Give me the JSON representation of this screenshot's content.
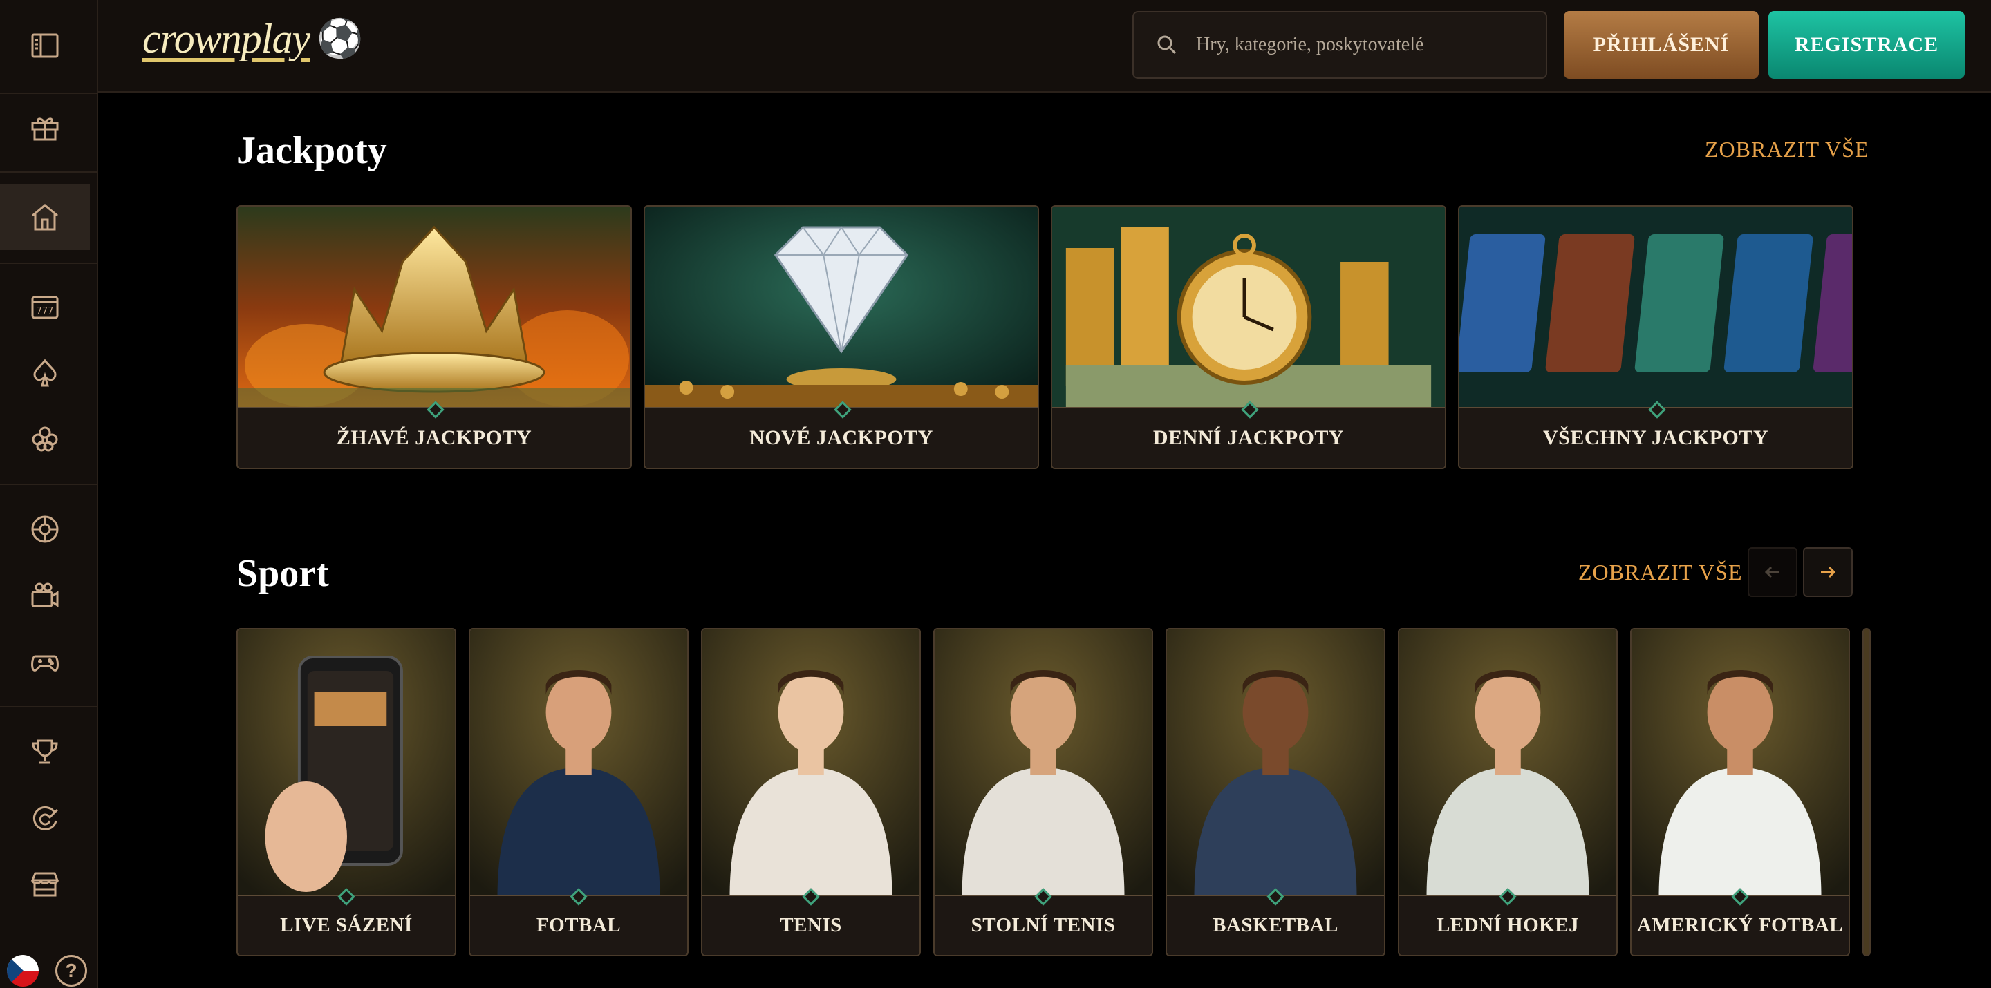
{
  "brand": {
    "logo_text": "crownplay",
    "logo_ball": "⚽"
  },
  "header": {
    "search_placeholder": "Hry, kategorie, poskytovatelé",
    "login_label": "PŘIHLÁŠENÍ",
    "register_label": "REGISTRACE"
  },
  "sidebar": {
    "icons": [
      "sidebar-toggle-icon",
      "gift-icon",
      "home-icon",
      "slot-machine-icon",
      "spade-icon",
      "clover-icon",
      "sports-ball-icon",
      "live-camera-icon",
      "gamepad-icon",
      "trophy-icon",
      "promotions-icon",
      "shop-icon"
    ],
    "help_label": "?",
    "language": "cs"
  },
  "jackpots": {
    "title": "Jackpoty",
    "show_all": "ZOBRAZIT VŠE",
    "cards": [
      {
        "label": "ŽHAVÉ JACKPOTY"
      },
      {
        "label": "NOVÉ JACKPOTY"
      },
      {
        "label": "DENNÍ JACKPOTY"
      },
      {
        "label": "VŠECHNY JACKPOTY"
      }
    ]
  },
  "sport": {
    "title": "Sport",
    "show_all": "ZOBRAZIT VŠE",
    "cards": [
      {
        "label": "LIVE SÁZENÍ"
      },
      {
        "label": "FOTBAL"
      },
      {
        "label": "TENIS"
      },
      {
        "label": "STOLNÍ TENIS"
      },
      {
        "label": "BASKETBAL"
      },
      {
        "label": "LEDNÍ HOKEJ"
      },
      {
        "label": "AMERICKÝ FOTBAL"
      }
    ]
  },
  "colors": {
    "accent_gold": "#e7a24a",
    "login_bronze": "#9a6432",
    "register_teal": "#14a889",
    "background": "#000000",
    "panel": "#140f0c"
  }
}
